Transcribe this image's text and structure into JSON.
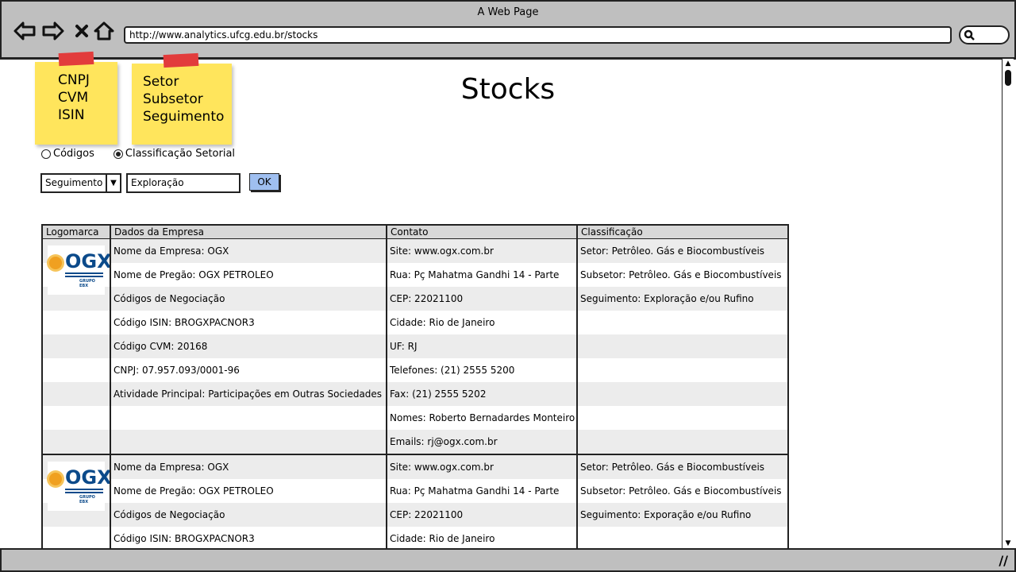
{
  "window": {
    "title": "A Web Page"
  },
  "browser": {
    "url": "http://www.analytics.ufcg.edu.br/stocks",
    "back_icon": "back-arrow-icon",
    "forward_icon": "forward-arrow-icon",
    "stop_icon": "close-icon",
    "home_icon": "home-icon"
  },
  "notes": [
    {
      "lines": [
        "CNPJ",
        "CVM",
        "ISIN"
      ]
    },
    {
      "lines": [
        "Setor",
        "Subsetor",
        "Seguimento"
      ]
    }
  ],
  "page": {
    "title": "Stocks"
  },
  "filter": {
    "radios": [
      {
        "label": "Códigos",
        "selected": false
      },
      {
        "label": "Classificação Setorial",
        "selected": true
      }
    ],
    "select_value": "Seguimento",
    "input_value": "Exploração",
    "ok_label": "OK"
  },
  "table": {
    "headers": [
      "Logomarca",
      "Dados da Empresa",
      "Contato",
      "Classificação"
    ],
    "logo_text": "OGX",
    "logo_subtext": "GRUPO EBX",
    "records": [
      {
        "rows": [
          [
            "Nome da Empresa: OGX",
            "Site: www.ogx.com.br",
            "Setor: Petrôleo. Gás e Biocombustíveis"
          ],
          [
            "Nome de Pregão: OGX PETROLEO",
            "Rua: Pç Mahatma Gandhi 14 - Parte",
            "Subsetor: Petrôleo. Gás e Biocombustíveis"
          ],
          [
            "Códigos de Negociação",
            "CEP: 22021100",
            "Seguimento: Exploração e/ou Rufino"
          ],
          [
            "Código ISIN: BROGXPACNOR3",
            "Cidade: Rio de Janeiro",
            ""
          ],
          [
            "Código CVM: 20168",
            "UF: RJ",
            ""
          ],
          [
            "CNPJ: 07.957.093/0001-96",
            "Telefones: (21) 2555 5200",
            ""
          ],
          [
            "Atividade Principal: Participações em Outras Sociedades",
            "Fax: (21) 2555 5202",
            ""
          ],
          [
            "",
            "Nomes: Roberto Bernadardes Monteiro",
            ""
          ],
          [
            "",
            "Emails: rj@ogx.com.br",
            ""
          ]
        ]
      },
      {
        "rows": [
          [
            "Nome da Empresa: OGX",
            "Site: www.ogx.com.br",
            "Setor: Petrôleo. Gás e Biocombustíveis"
          ],
          [
            "Nome de Pregão: OGX PETROLEO",
            "Rua: Pç Mahatma Gandhi 14 - Parte",
            "Subsetor: Petrôleo. Gás e Biocombustíveis"
          ],
          [
            "Códigos de Negociação",
            "CEP: 22021100",
            "Seguimento: Exporação e/ou Rufino"
          ],
          [
            "Código ISIN: BROGXPACNOR3",
            "Cidade: Rio de Janeiro",
            ""
          ]
        ]
      }
    ]
  },
  "colors": {
    "chrome": "#bfbfbf",
    "sticky": "#ffe55c",
    "tape": "#e23c3c",
    "button": "#9fbff0"
  }
}
